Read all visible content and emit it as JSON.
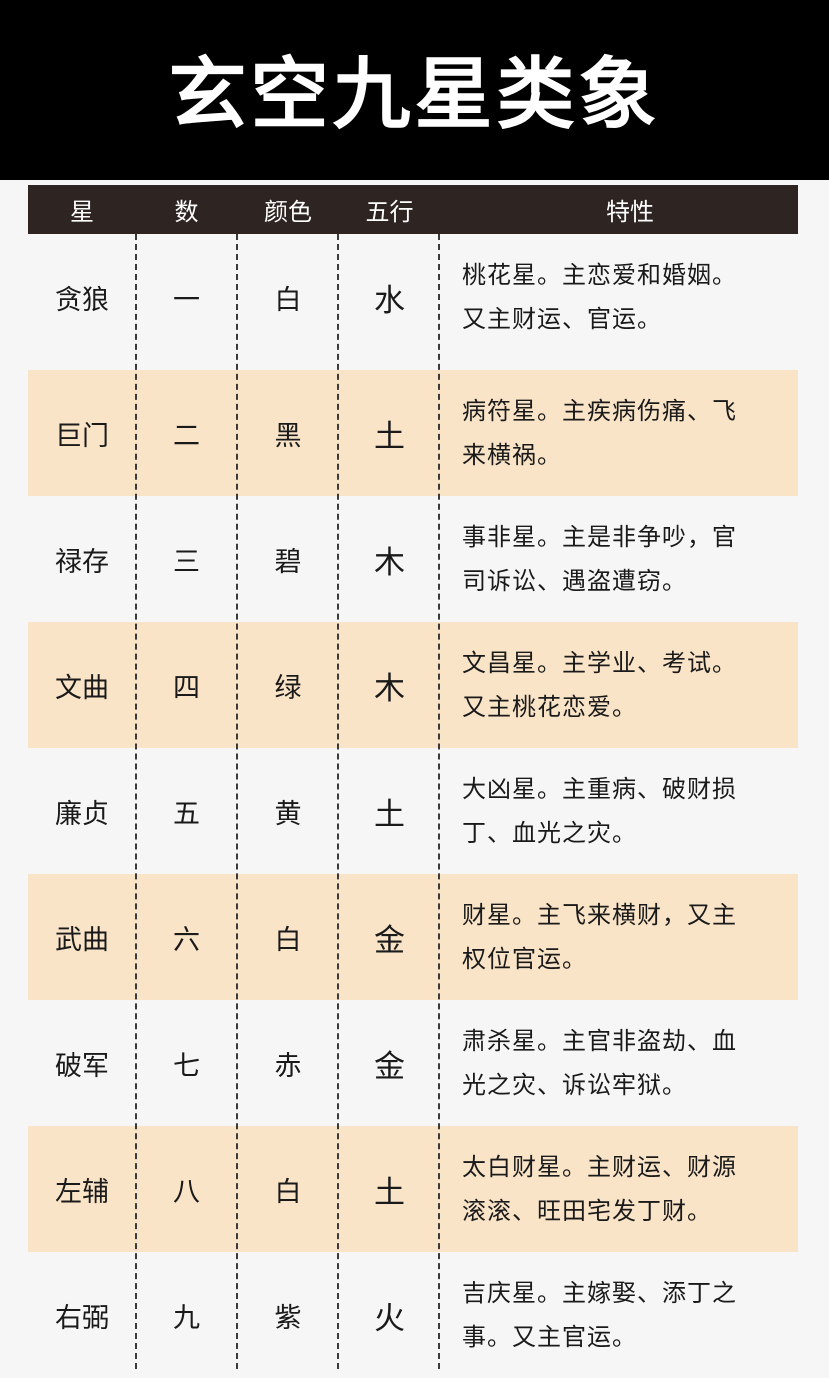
{
  "title": "玄空九星类象",
  "colors": {
    "title_bg": "#000000",
    "header_bg": "#2e2523",
    "row_shade": "#f9e4c8",
    "page_bg": "#f6f6f6"
  },
  "headers": [
    "星",
    "数",
    "颜色",
    "五行",
    "特性"
  ],
  "rows": [
    {
      "star": "贪狼",
      "num": "一",
      "color": "白",
      "wuxing": "水",
      "desc": [
        "桃花星。主恋爱和婚姻。",
        "又主财运、官运。"
      ]
    },
    {
      "star": "巨门",
      "num": "二",
      "color": "黑",
      "wuxing": "土",
      "desc": [
        "病符星。主疾病伤痛、飞",
        "来横祸。"
      ]
    },
    {
      "star": "禄存",
      "num": "三",
      "color": "碧",
      "wuxing": "木",
      "desc": [
        "事非星。主是非争吵，官",
        "司诉讼、遇盗遭窃。"
      ]
    },
    {
      "star": "文曲",
      "num": "四",
      "color": "绿",
      "wuxing": "木",
      "desc": [
        "文昌星。主学业、考试。",
        "又主桃花恋爱。"
      ]
    },
    {
      "star": "廉贞",
      "num": "五",
      "color": "黄",
      "wuxing": "土",
      "desc": [
        "大凶星。主重病、破财损",
        "丁、血光之灾。"
      ]
    },
    {
      "star": "武曲",
      "num": "六",
      "color": "白",
      "wuxing": "金",
      "desc": [
        "财星。主飞来横财，又主",
        "权位官运。"
      ]
    },
    {
      "star": "破军",
      "num": "七",
      "color": "赤",
      "wuxing": "金",
      "desc": [
        "肃杀星。主官非盗劫、血",
        "光之灾、诉讼牢狱。"
      ]
    },
    {
      "star": "左辅",
      "num": "八",
      "color": "白",
      "wuxing": "土",
      "desc": [
        "太白财星。主财运、财源",
        "滚滚、旺田宅发丁财。"
      ]
    },
    {
      "star": "右弼",
      "num": "九",
      "color": "紫",
      "wuxing": "火",
      "desc": [
        "吉庆星。主嫁娶、添丁之",
        "事。又主官运。"
      ]
    }
  ]
}
